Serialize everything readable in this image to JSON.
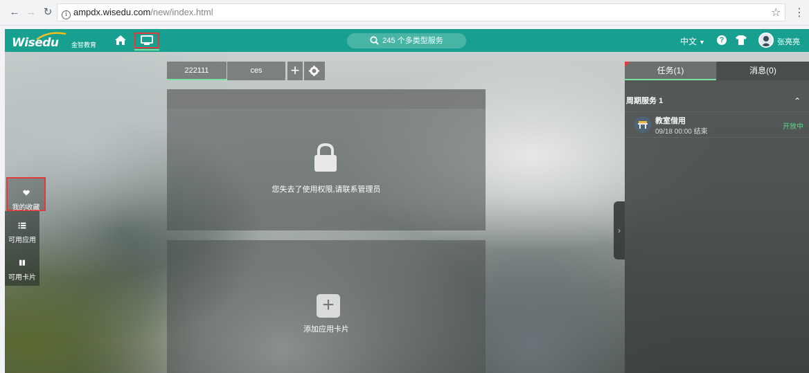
{
  "browser": {
    "url_host": "ampdx.wisedu.com",
    "url_path": "/new/index.html"
  },
  "header": {
    "brand": "Wisedu",
    "brand_cn": "金智教育",
    "search_label": "245 个多类型服务",
    "language": "中文",
    "username": "张亮亮",
    "accent_color": "#17a08f"
  },
  "left_nav": {
    "items": [
      {
        "label": "我的收藏",
        "icon": "heart-icon"
      },
      {
        "label": "可用应用",
        "icon": "list-icon"
      },
      {
        "label": "可用卡片",
        "icon": "columns-icon"
      }
    ]
  },
  "card_tabs": {
    "tabs": [
      {
        "label": "222111"
      },
      {
        "label": "ces"
      }
    ]
  },
  "cards": {
    "no_permission_text": "您失去了使用权限,请联系管理员",
    "add_card_text": "添加应用卡片"
  },
  "right_panel": {
    "tabs": [
      {
        "label": "任务(1)"
      },
      {
        "label": "消息(0)"
      }
    ],
    "section_title": "周期服务",
    "section_count": "1",
    "items": [
      {
        "title": "教室借用",
        "time": "09/18 00:00 结束",
        "status": "开放中"
      }
    ]
  }
}
